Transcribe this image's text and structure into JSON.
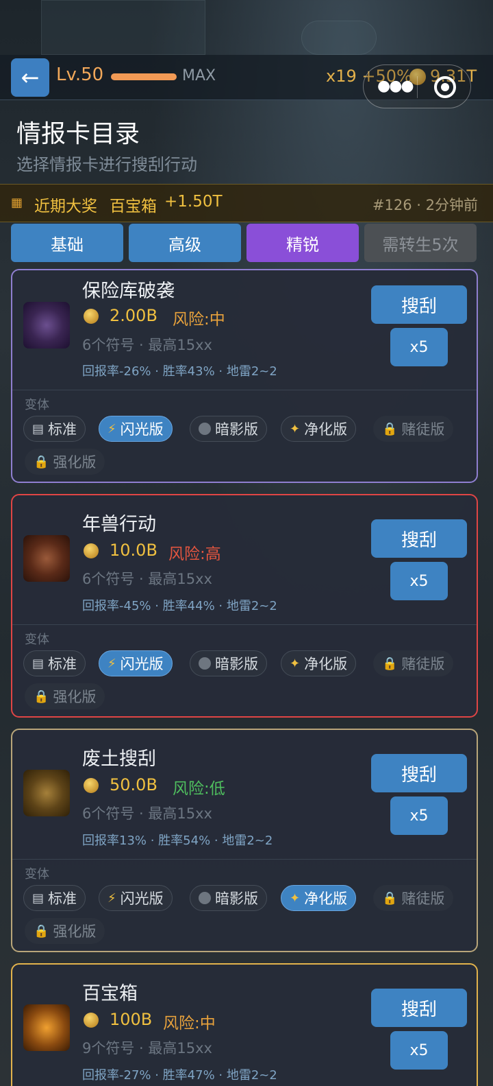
{
  "header": {
    "level": "Lv.50",
    "level_status": "MAX",
    "multiplier": "x19 +50%",
    "balance": "9.31T",
    "back_icon": "arrow-left-icon"
  },
  "page": {
    "title": "情报卡目录",
    "subtitle": "选择情报卡进行搜刮行动"
  },
  "jackpot": {
    "label": "近期大奖",
    "name": "百宝箱",
    "amount": "+1.50T",
    "meta": "#126 · 2分钟前"
  },
  "tabs": [
    {
      "label": "基础"
    },
    {
      "label": "高级"
    },
    {
      "label": "精锐"
    },
    {
      "label": "需转生5次"
    }
  ],
  "variants_label": "变体",
  "variant_names": [
    "标准",
    "闪光版",
    "暗影版",
    "净化版",
    "赌徒版",
    "强化版"
  ],
  "cards": [
    {
      "title": "保险库破袭",
      "cost": "2.00B",
      "risk": "风险:中",
      "risk_color": "#e8a23c",
      "symbols": "6个符号 · 最高15xx",
      "stats": "回报率-26% · 胜率43% · 地雷2~2",
      "scrape": "搜刮",
      "multi": "x5",
      "active_variant": "闪光版"
    },
    {
      "title": "年兽行动",
      "cost": "10.0B",
      "risk": "风险:高",
      "risk_color": "#e2553f",
      "symbols": "6个符号 · 最高15xx",
      "stats": "回报率-45% · 胜率44% · 地雷2~2",
      "scrape": "搜刮",
      "multi": "x5",
      "active_variant": "闪光版"
    },
    {
      "title": "废土搜刮",
      "cost": "50.0B",
      "risk": "风险:低",
      "risk_color": "#4fbf5e",
      "symbols": "6个符号 · 最高15xx",
      "stats": "回报率13% · 胜率54% · 地雷2~2",
      "scrape": "搜刮",
      "multi": "x5",
      "active_variant": "净化版"
    },
    {
      "title": "百宝箱",
      "cost": "100B",
      "risk": "风险:中",
      "risk_color": "#e8a23c",
      "symbols": "9个符号 · 最高15xx",
      "stats": "回报率-27% · 胜率47% · 地雷2~2",
      "scrape": "搜刮",
      "multi": "x5"
    }
  ]
}
